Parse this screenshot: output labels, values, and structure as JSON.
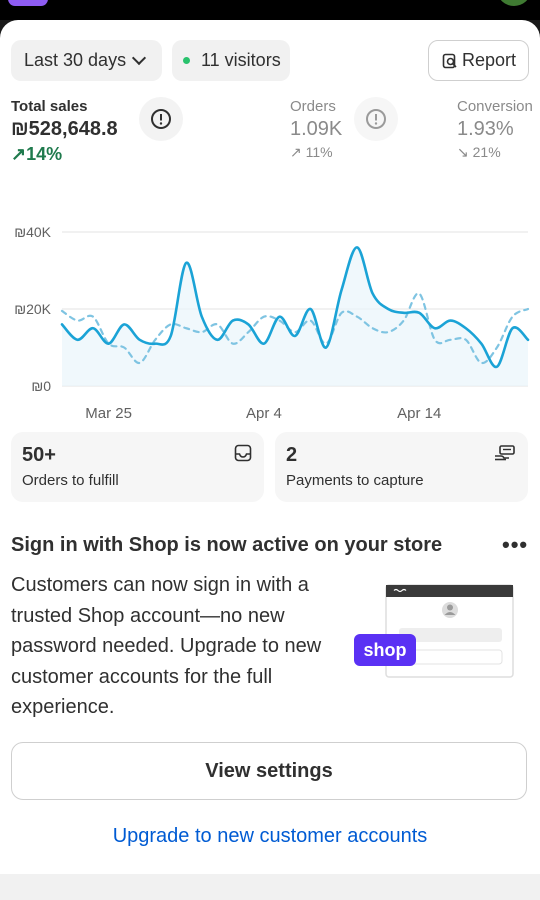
{
  "filters": {
    "date_range": "Last 30 days",
    "visitors": "11 visitors",
    "report": "Report"
  },
  "metrics": {
    "total_sales": {
      "label": "Total sales",
      "value": "₪528,648.8",
      "delta": "14%"
    },
    "orders": {
      "label": "Orders",
      "value": "1.09K",
      "delta": "11%"
    },
    "conversion": {
      "label": "Conversion",
      "value": "1.93%",
      "delta": "21%"
    }
  },
  "chart_data": {
    "type": "line",
    "y_ticks": [
      "₪40K",
      "₪20K",
      "₪0"
    ],
    "ylim": [
      0,
      40000
    ],
    "x_ticks": [
      "Mar 25",
      "Apr 4",
      "Apr 14"
    ],
    "categories": [
      "Mar 22",
      "Mar 23",
      "Mar 24",
      "Mar 25",
      "Mar 26",
      "Mar 27",
      "Mar 28",
      "Mar 29",
      "Mar 30",
      "Mar 31",
      "Apr 1",
      "Apr 2",
      "Apr 3",
      "Apr 4",
      "Apr 5",
      "Apr 6",
      "Apr 7",
      "Apr 8",
      "Apr 9",
      "Apr 10",
      "Apr 11",
      "Apr 12",
      "Apr 13",
      "Apr 14",
      "Apr 15",
      "Apr 16",
      "Apr 17",
      "Apr 18",
      "Apr 19",
      "Apr 20",
      "Apr 21"
    ],
    "series": [
      {
        "style": "solid",
        "color": "#1ba3d6",
        "values": [
          16000,
          12000,
          15000,
          11000,
          16000,
          12000,
          11000,
          13000,
          32000,
          18000,
          12000,
          17000,
          16000,
          11000,
          18000,
          13000,
          20000,
          10000,
          25000,
          36000,
          24000,
          20000,
          19000,
          19000,
          15000,
          17000,
          15000,
          11000,
          5000,
          15000,
          12000
        ]
      },
      {
        "style": "dashed",
        "color": "#7fc4e2",
        "values": [
          19500,
          17000,
          18000,
          11000,
          10000,
          6000,
          12000,
          16000,
          15000,
          14000,
          16000,
          11000,
          14000,
          18000,
          17000,
          14000,
          17000,
          11000,
          19000,
          18000,
          15000,
          14000,
          17000,
          24000,
          12000,
          12000,
          12000,
          6000,
          10000,
          18000,
          20000
        ]
      }
    ]
  },
  "tiles": {
    "fulfill": {
      "count": "50+",
      "label": "Orders to fulfill"
    },
    "capture": {
      "count": "2",
      "label": "Payments to capture"
    }
  },
  "promo": {
    "title": "Sign in with Shop is now active on your store",
    "body": "Customers can now sign in with a trusted Shop account—no new password needed. Upgrade to new customer accounts for the full experience.",
    "badge": "shop",
    "more": "•••",
    "view_settings": "View settings",
    "upgrade_link": "Upgrade to new customer accounts"
  },
  "colors": {
    "accent_link": "#005bd3",
    "positive": "#1f7a4d",
    "chart_line": "#1ba3d6",
    "shop_badge": "#5a31f4"
  }
}
